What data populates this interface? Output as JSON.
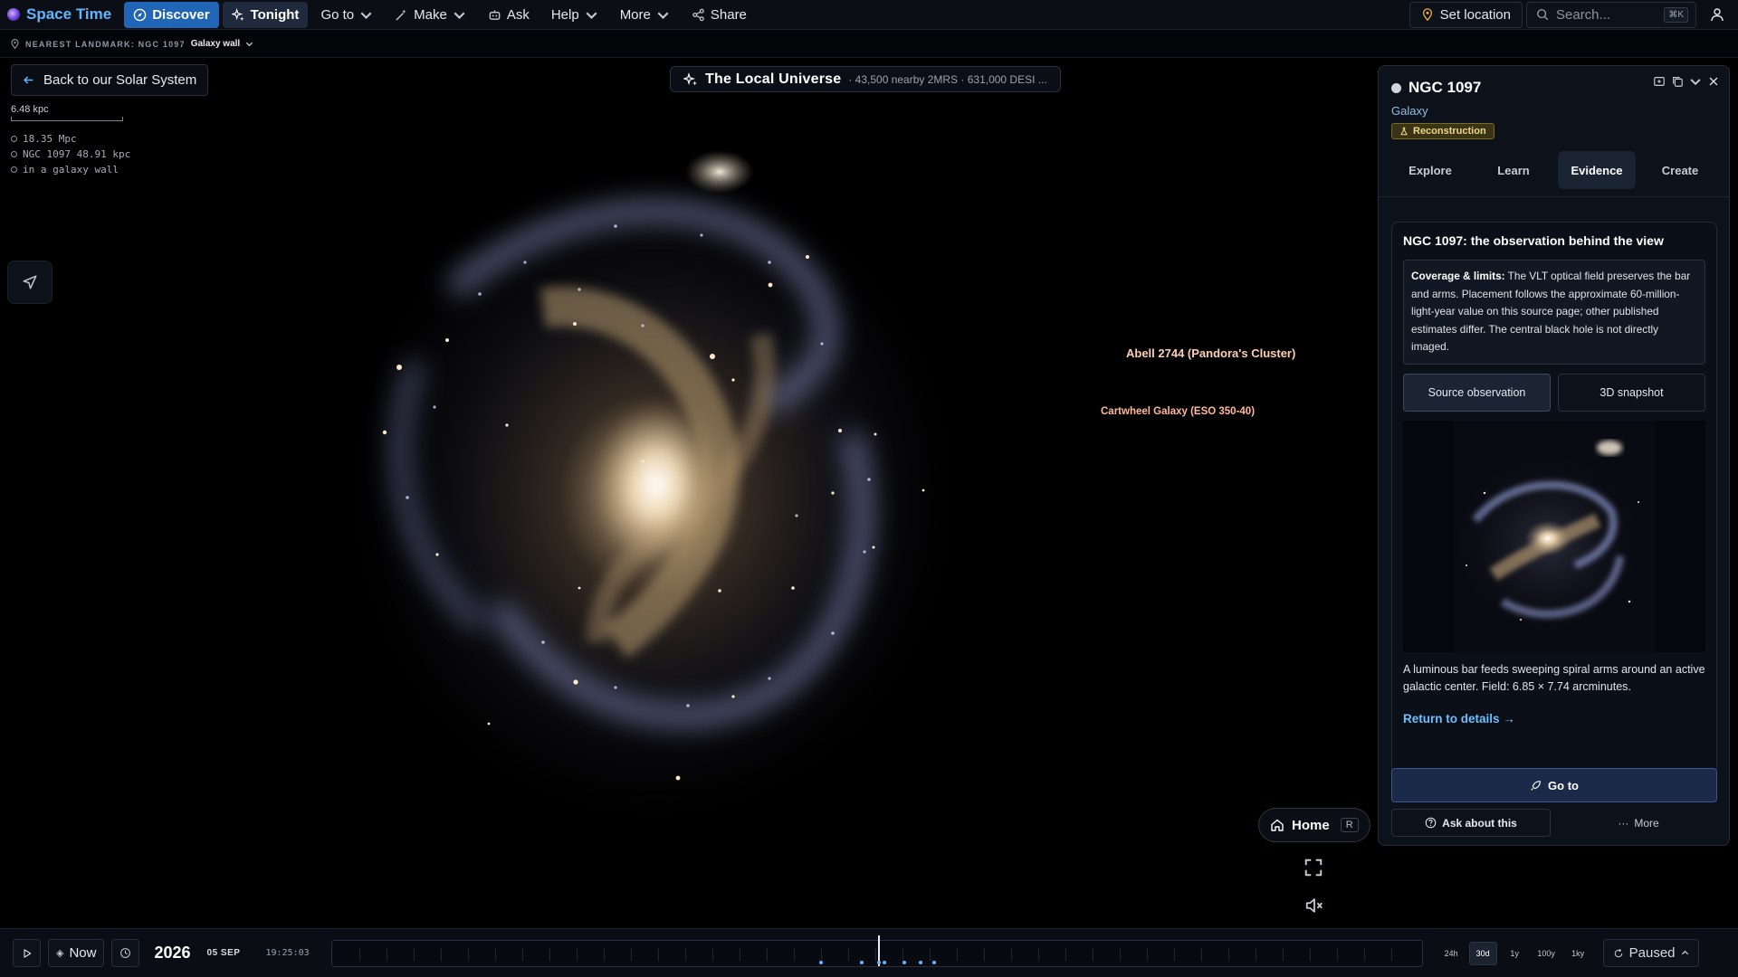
{
  "nav": {
    "brand": "Space Time",
    "items": [
      {
        "id": "discover",
        "label": "Discover",
        "icon": "compass-icon"
      },
      {
        "id": "tonight",
        "label": "Tonight",
        "icon": "sparkle-icon"
      },
      {
        "id": "goto",
        "label": "Go to",
        "icon": ""
      },
      {
        "id": "make",
        "label": "Make",
        "icon": "wand-icon"
      },
      {
        "id": "ask",
        "label": "Ask",
        "icon": "bot-icon"
      },
      {
        "id": "help",
        "label": "Help",
        "icon": ""
      },
      {
        "id": "more",
        "label": "More",
        "icon": ""
      },
      {
        "id": "share",
        "label": "Share",
        "icon": "share-icon"
      }
    ],
    "set_location": "Set location",
    "search_placeholder": "Search...",
    "search_shortcut": "⌘K"
  },
  "landmark": {
    "label": "NEAREST LANDMARK: NGC 1097",
    "value": "Galaxy wall"
  },
  "viewport": {
    "back_label": "Back to our Solar System",
    "scale_label": "6.48 kpc",
    "readout": [
      "18.35 Mpc",
      "NGC 1097 48.91 kpc",
      "in a galaxy wall"
    ],
    "title": "The Local Universe",
    "subtitle": "· 43,500 nearby 2MRS · 631,000 DESI ...",
    "labels": {
      "abell": "Abell 2744 (Pandora's Cluster)",
      "cartwheel": "Cartwheel Galaxy (ESO 350-40)"
    },
    "home_label": "Home",
    "home_key": "R"
  },
  "panel": {
    "name": "NGC 1097",
    "type": "Galaxy",
    "badge": "Reconstruction",
    "tabs": [
      "Explore",
      "Learn",
      "Evidence",
      "Create"
    ],
    "active_tab": "Evidence",
    "evidence": {
      "title": "NGC 1097: the observation behind the view",
      "note_heading": "Coverage & limits:",
      "note_body": "The VLT optical field preserves the bar and arms. Placement follows the approximate 60-million-light-year value on this source page; other published estimates differ. The central black hole is not directly imaged.",
      "btn_source": "Source observation",
      "btn_snapshot": "3D snapshot",
      "caption": "A luminous bar feeds sweeping spiral arms around an active galactic center. Field: 6.85 × 7.74 arcminutes.",
      "return_link": "Return to details →"
    },
    "goto_label": "Go to",
    "ask_label": "Ask about this",
    "more_label": "More"
  },
  "timeline": {
    "now_label": "Now",
    "year": "2026",
    "date": "05 SEP",
    "time": "19:25:03",
    "scales": [
      "24h",
      "30d",
      "1y",
      "100y",
      "1ky"
    ],
    "active_scale": "30d",
    "status": "Paused"
  },
  "colors": {
    "accent": "#2065b6",
    "brand": "#5fb6ff",
    "link": "#6fbfff",
    "badge": "#f0d68a",
    "label": "#ffcfb0"
  }
}
